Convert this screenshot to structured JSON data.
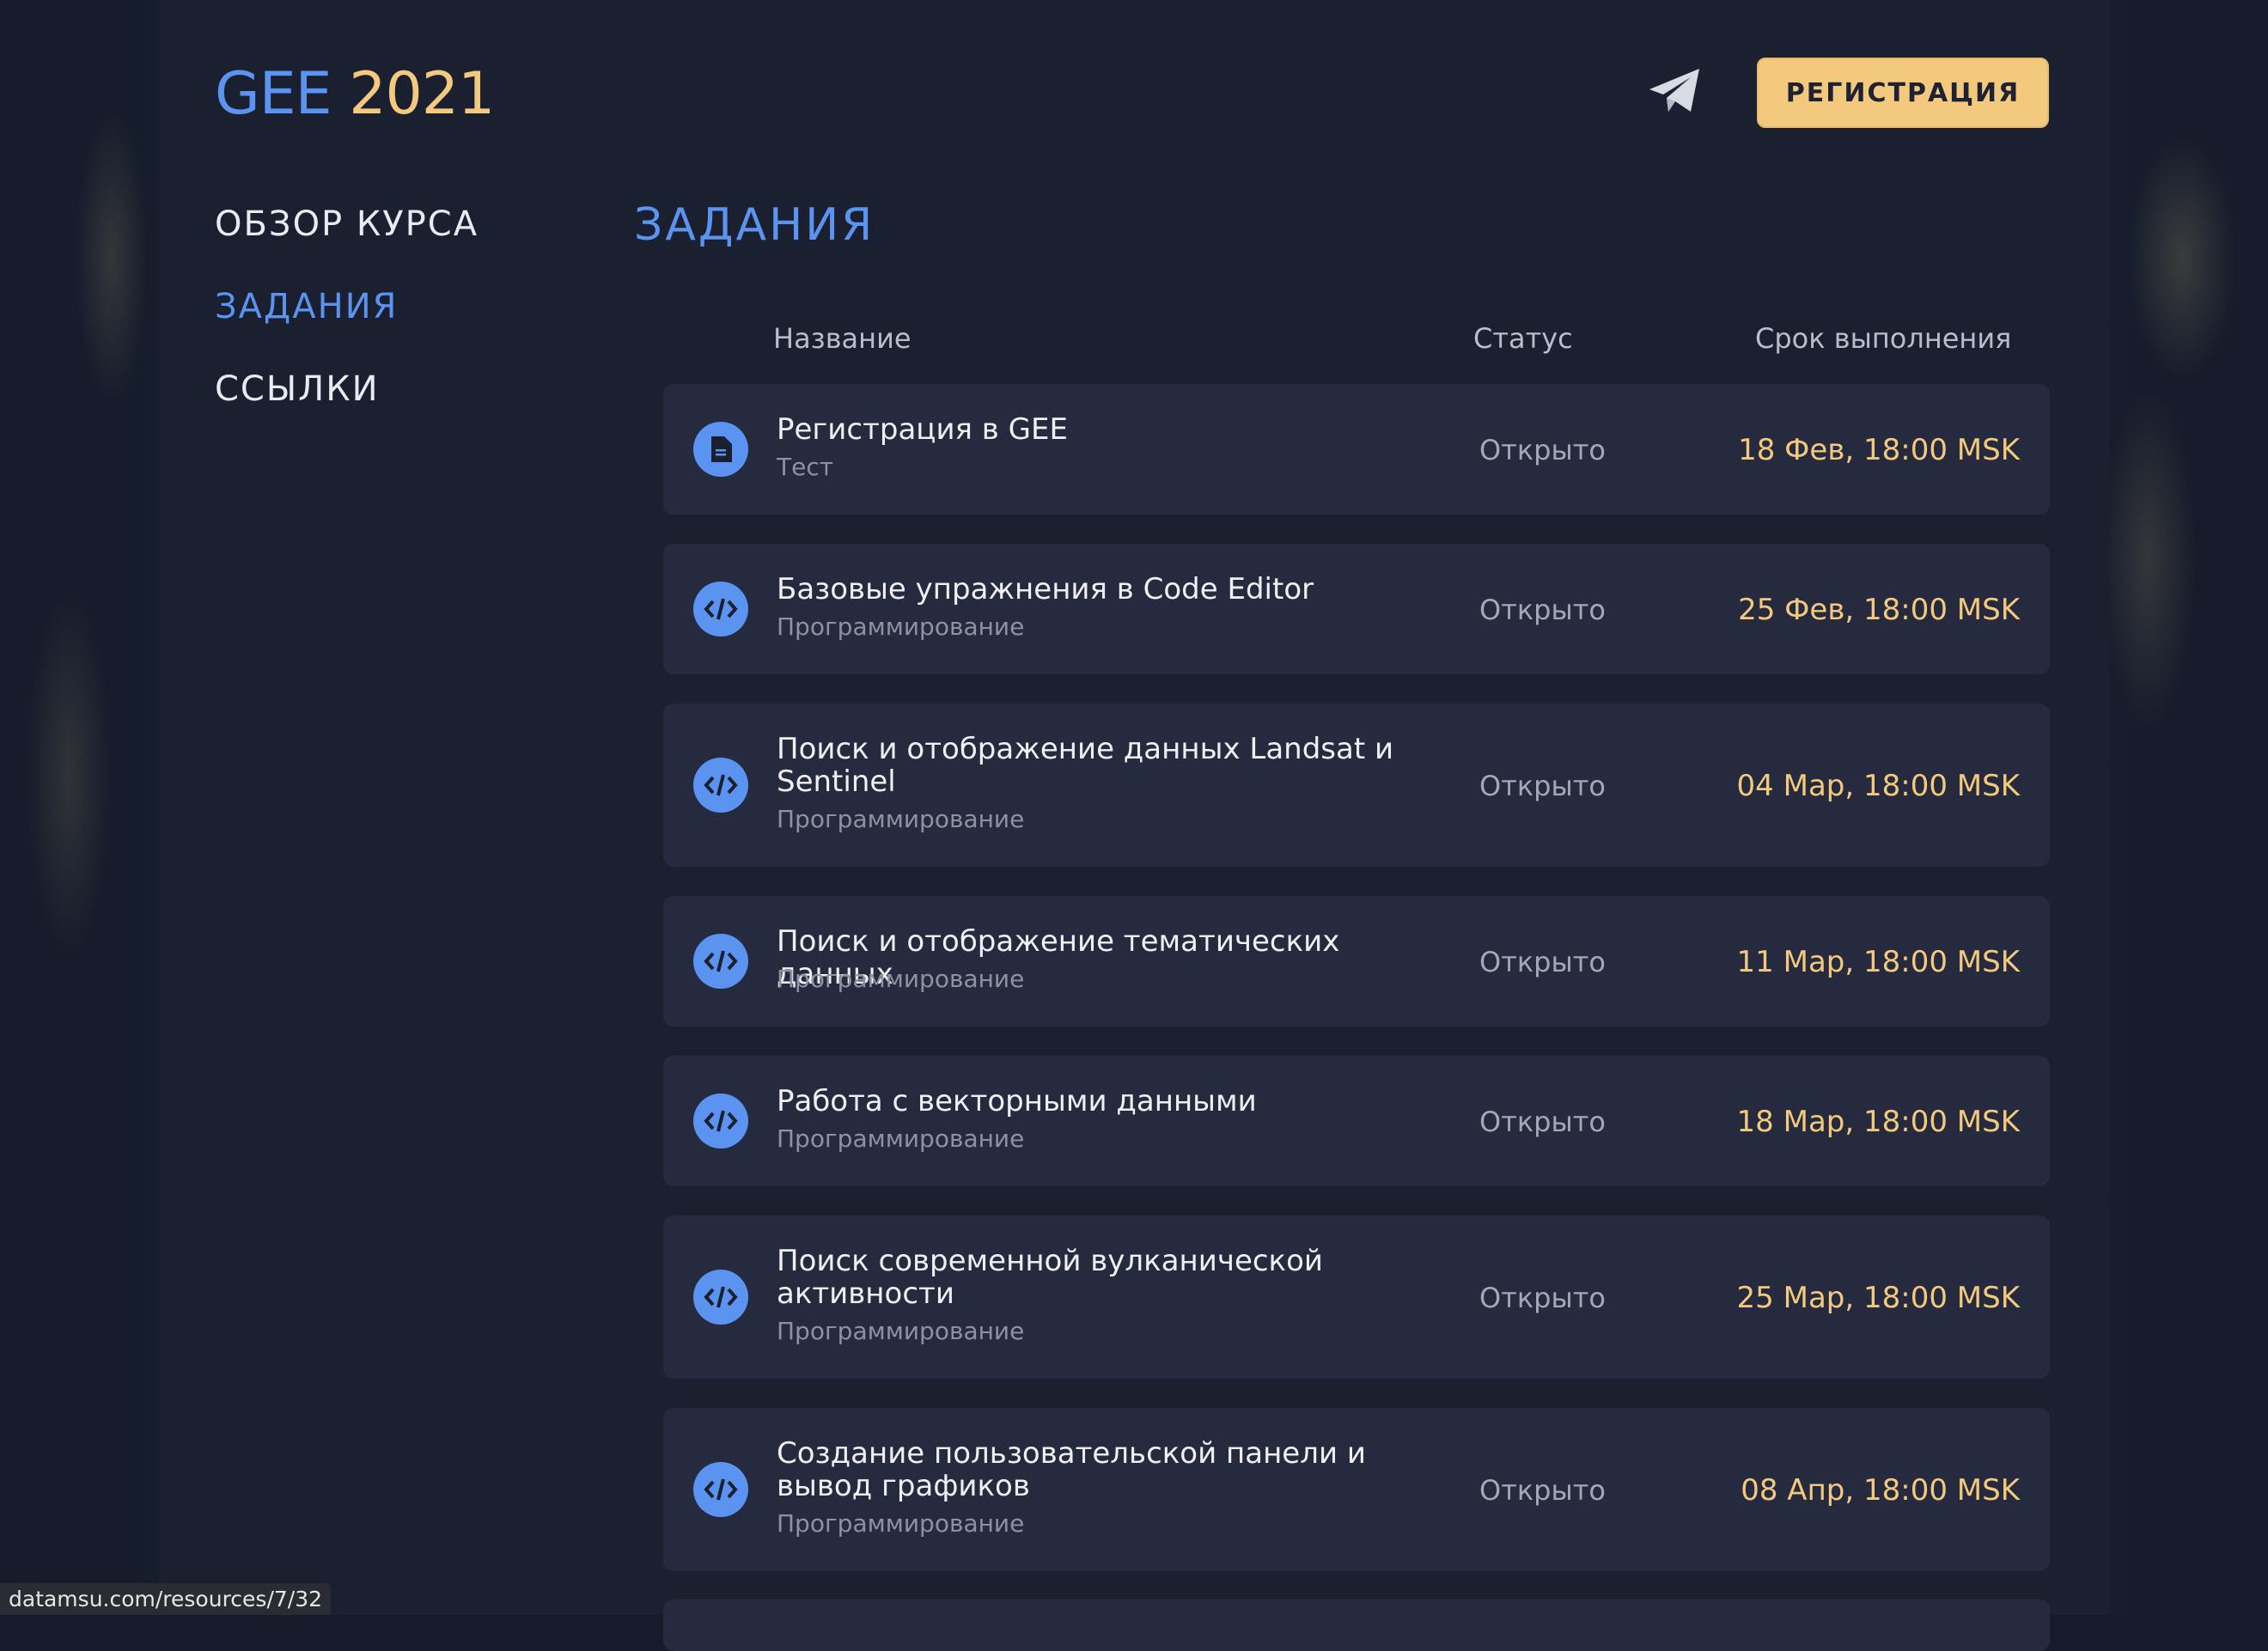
{
  "header": {
    "logo_gee": "GEE",
    "logo_year": "2021",
    "register_label": "РЕГИСТРАЦИЯ"
  },
  "nav": [
    {
      "label": "ОБЗОР КУРСА",
      "active": false
    },
    {
      "label": "ЗАДАНИЯ",
      "active": true
    },
    {
      "label": "ССЫЛКИ",
      "active": false
    }
  ],
  "main": {
    "title": "ЗАДАНИЯ",
    "columns": {
      "name": "Название",
      "status": "Статус",
      "deadline": "Срок выполнения"
    },
    "tasks": [
      {
        "title": "Регистрация в GEE",
        "type": "Тест",
        "icon": "document-icon",
        "status": "Открыто",
        "deadline": "18 Фев, 18:00 MSK"
      },
      {
        "title": "Базовые упражнения в Code Editor",
        "type": "Программирование",
        "icon": "code-icon",
        "status": "Открыто",
        "deadline": "25 Фев, 18:00 MSK"
      },
      {
        "title": "Поиск и отображение данных Landsat и Sentinel",
        "type": "Программирование",
        "icon": "code-icon",
        "status": "Открыто",
        "deadline": "04 Мар, 18:00 MSK"
      },
      {
        "title": "Поиск и отображение тематических данных",
        "type": "Программирование",
        "icon": "code-icon",
        "status": "Открыто",
        "deadline": "11 Мар, 18:00 MSK"
      },
      {
        "title": "Работа с векторными данными",
        "type": "Программирование",
        "icon": "code-icon",
        "status": "Открыто",
        "deadline": "18 Мар, 18:00 MSK"
      },
      {
        "title": "Поиск современной вулканической активности",
        "type": "Программирование",
        "icon": "code-icon",
        "status": "Открыто",
        "deadline": "25 Мар, 18:00 MSK"
      },
      {
        "title": "Создание пользовательской панели и вывод графиков",
        "type": "Программирование",
        "icon": "code-icon",
        "status": "Открыто",
        "deadline": "08 Апр, 18:00 MSK"
      }
    ]
  },
  "statusbar": {
    "url": "datamsu.com/resources/7/32"
  },
  "colors": {
    "accent_blue": "#5b93f0",
    "accent_gold": "#f2c97d",
    "card_bg": "#252a3e",
    "panel_bg": "#1b2031"
  }
}
